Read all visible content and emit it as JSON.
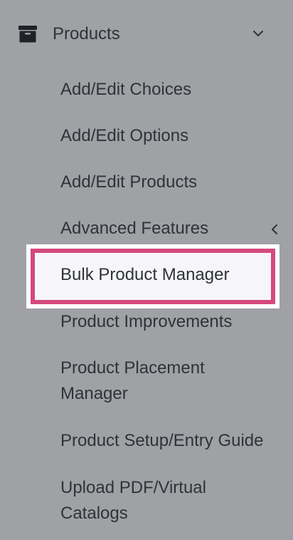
{
  "section": {
    "label": "Products",
    "icon": "archive-box-icon",
    "chevron": "chevron-down-icon",
    "expanded": true
  },
  "items": [
    {
      "label": "Add/Edit Choices"
    },
    {
      "label": "Add/Edit Options"
    },
    {
      "label": "Add/Edit Products"
    },
    {
      "label": "Advanced Features",
      "icon": "chevron-left-icon"
    },
    {
      "label": "Bulk Product Manager",
      "highlighted": true
    },
    {
      "label": "Product Improvements"
    },
    {
      "label": "Product Placement Manager"
    },
    {
      "label": "Product Setup/Entry Guide"
    },
    {
      "label": "Upload PDF/Virtual Catalogs"
    }
  ],
  "colors": {
    "background": "#9fa1a4",
    "text": "#2f3339",
    "highlight_border": "#d5497a",
    "highlight_fill": "#f6f6f9"
  }
}
